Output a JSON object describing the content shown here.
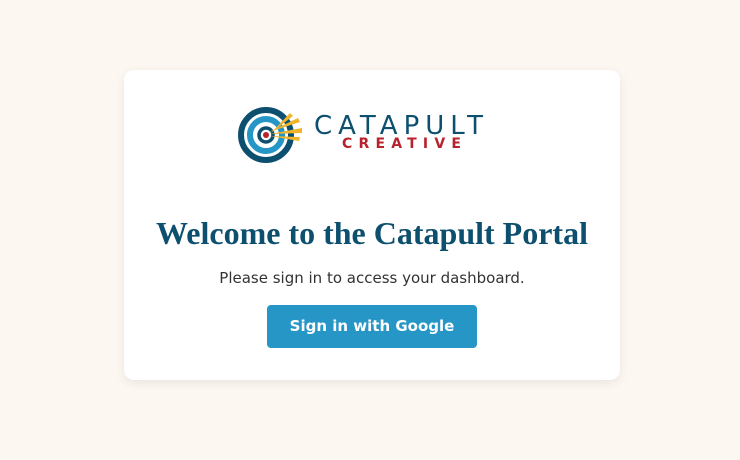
{
  "brand": {
    "name": "CATAPULT",
    "tagline": "CREATIVE",
    "icon": "target-logo-icon",
    "colors": {
      "navy": "#0d4f6e",
      "blue": "#2596c6",
      "red": "#b7222c",
      "gold": "#f2b42a"
    }
  },
  "login": {
    "title": "Welcome to the Catapult Portal",
    "subtitle": "Please sign in to access your dashboard.",
    "button_label": "Sign in with Google"
  }
}
